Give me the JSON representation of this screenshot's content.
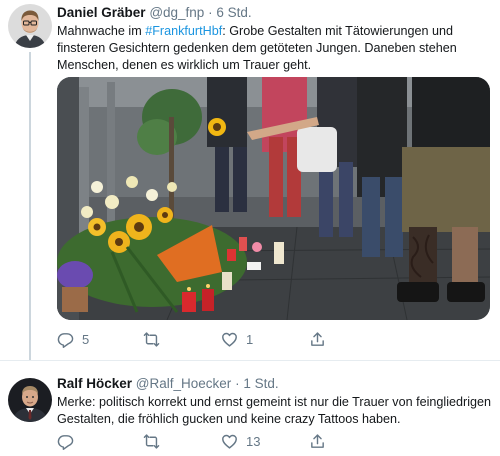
{
  "tweets": [
    {
      "name": "Daniel Gräber",
      "handle": "@dg_fnp",
      "separator": "·",
      "time": "6 Std.",
      "text_before": "Mahnwache im ",
      "hashtag": "#FrankfurtHbf",
      "text_after": ": Grobe Gestalten mit Tätowierungen und finsteren Gesichtern gedenken dem getöteten Jungen. Daneben stehen Menschen, denen es wirklich um Trauer geht.",
      "replies": "5",
      "retweets": "",
      "likes": "1",
      "share": ""
    },
    {
      "name": "Ralf Höcker",
      "handle": "@Ralf_Hoecker",
      "separator": "·",
      "time": "1 Std.",
      "text": "Merke: politisch korrekt und ernst gemeint ist nur die Trauer von feingliedrigen Gestalten, die fröhlich gucken und keine crazy Tattoos haben.",
      "replies": "",
      "retweets": "",
      "likes": "13",
      "share": ""
    }
  ],
  "icons": {
    "reply": "reply-icon",
    "retweet": "retweet-icon",
    "like": "heart-icon",
    "share": "share-icon"
  },
  "colors": {
    "link": "#1b95e0",
    "secondary_text": "#657786",
    "divider": "#e6ecf0",
    "thread_line": "#ccd6dd"
  }
}
